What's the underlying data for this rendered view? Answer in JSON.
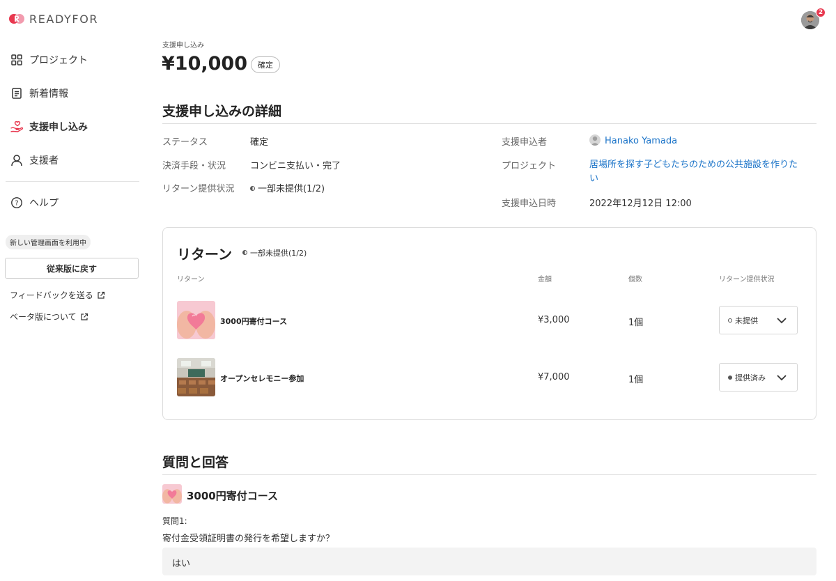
{
  "brand": {
    "name": "READYFOR",
    "accent": "#e8384f"
  },
  "sidebar": {
    "items": [
      {
        "label": "プロジェクト",
        "icon": "grid-icon",
        "active": false
      },
      {
        "label": "新着情報",
        "icon": "document-icon",
        "active": false
      },
      {
        "label": "支援申し込み",
        "icon": "hand-heart-icon",
        "active": true
      },
      {
        "label": "支援者",
        "icon": "person-icon",
        "active": false
      }
    ],
    "help_label": "ヘルプ",
    "new_ui_pill": "新しい管理画面を利用中",
    "legacy_button": "従来版に戻す",
    "feedback_link": "フィードバックを送る",
    "beta_link": "ベータ版について"
  },
  "header": {
    "notification_count": "2"
  },
  "summary": {
    "kicker": "支援申し込み",
    "amount": "¥10,000",
    "status_badge": "確定"
  },
  "details": {
    "title": "支援申し込みの詳細",
    "left": [
      {
        "label": "ステータス",
        "value": "確定"
      },
      {
        "label": "決済手段・状況",
        "value": "コンビニ支払い・完了"
      },
      {
        "label": "リターン提供状況",
        "value": "一部未提供(1/2)"
      }
    ],
    "supporter_label": "支援申込者",
    "supporter_name": "Hanako Yamada",
    "project_label": "プロジェクト",
    "project_line1": "居場所を探す子どもたちのための公共施設を作りた",
    "project_line2": "い",
    "date_label": "支援申込日時",
    "date_value": "2022年12月12日 12:00"
  },
  "returns": {
    "title": "リターン",
    "status": "一部未提供(1/2)",
    "columns": [
      "リターン",
      "金額",
      "個数",
      "リターン提供状況"
    ],
    "rows": [
      {
        "name": "3000円寄付コース",
        "amount": "¥3,000",
        "qty": "1個",
        "status": "未提供",
        "thumb": "heart-hands-thumbnail"
      },
      {
        "name": "オープンセレモニー参加",
        "amount": "¥7,000",
        "qty": "1個",
        "status": "提供済み",
        "thumb": "classroom-thumbnail"
      }
    ]
  },
  "qa": {
    "title": "質問と回答",
    "course": "3000円寄付コース",
    "question_label": "質問1:",
    "question": "寄付金受領証明書の発行を希望しますか？",
    "answer": "はい"
  }
}
